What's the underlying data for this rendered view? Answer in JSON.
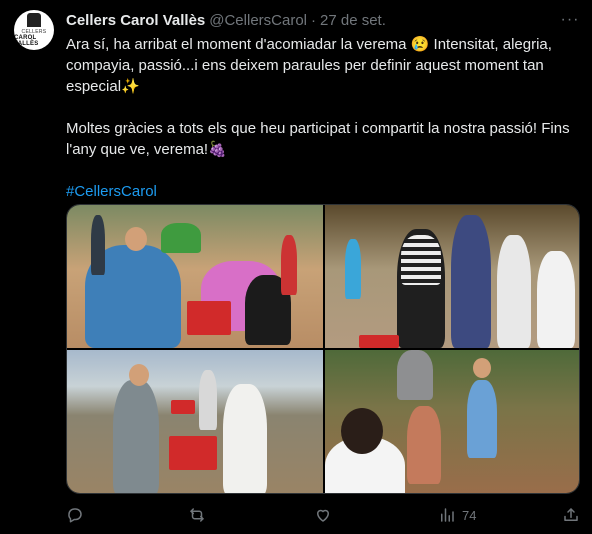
{
  "account": {
    "name": "Cellers Carol Vallès",
    "handle": "@CellersCarol",
    "separator": "·",
    "date": "27 de set.",
    "avatar_text_top": "CELLERS",
    "avatar_text_bottom": "CAROL VALLÈS"
  },
  "more_label": "···",
  "tweet": {
    "paragraph1": "Ara sí, ha arribat el moment d'acomiadar la verema 😢 Intensitat, alegria, compayia, passió...i ens deixem paraules per definir aquest moment tan especial✨",
    "paragraph2": "Moltes gràcies a tots els que heu participat i compartit la nostra passió! Fins l'any que ve, verema!🍇",
    "hashtag": "#CellersCarol"
  },
  "media": {
    "photos": [
      {
        "name": "harvest-photo-1"
      },
      {
        "name": "harvest-photo-2"
      },
      {
        "name": "harvest-photo-3"
      },
      {
        "name": "harvest-photo-4"
      }
    ]
  },
  "actions": {
    "reply_icon": "reply-icon",
    "retweet_icon": "retweet-icon",
    "like_icon": "like-icon",
    "views_icon": "views-icon",
    "views_count": "74",
    "share_icon": "share-icon"
  },
  "colors": {
    "background": "#000000",
    "text": "#e7e9ea",
    "muted": "#71767b",
    "link": "#1d9bf0"
  }
}
